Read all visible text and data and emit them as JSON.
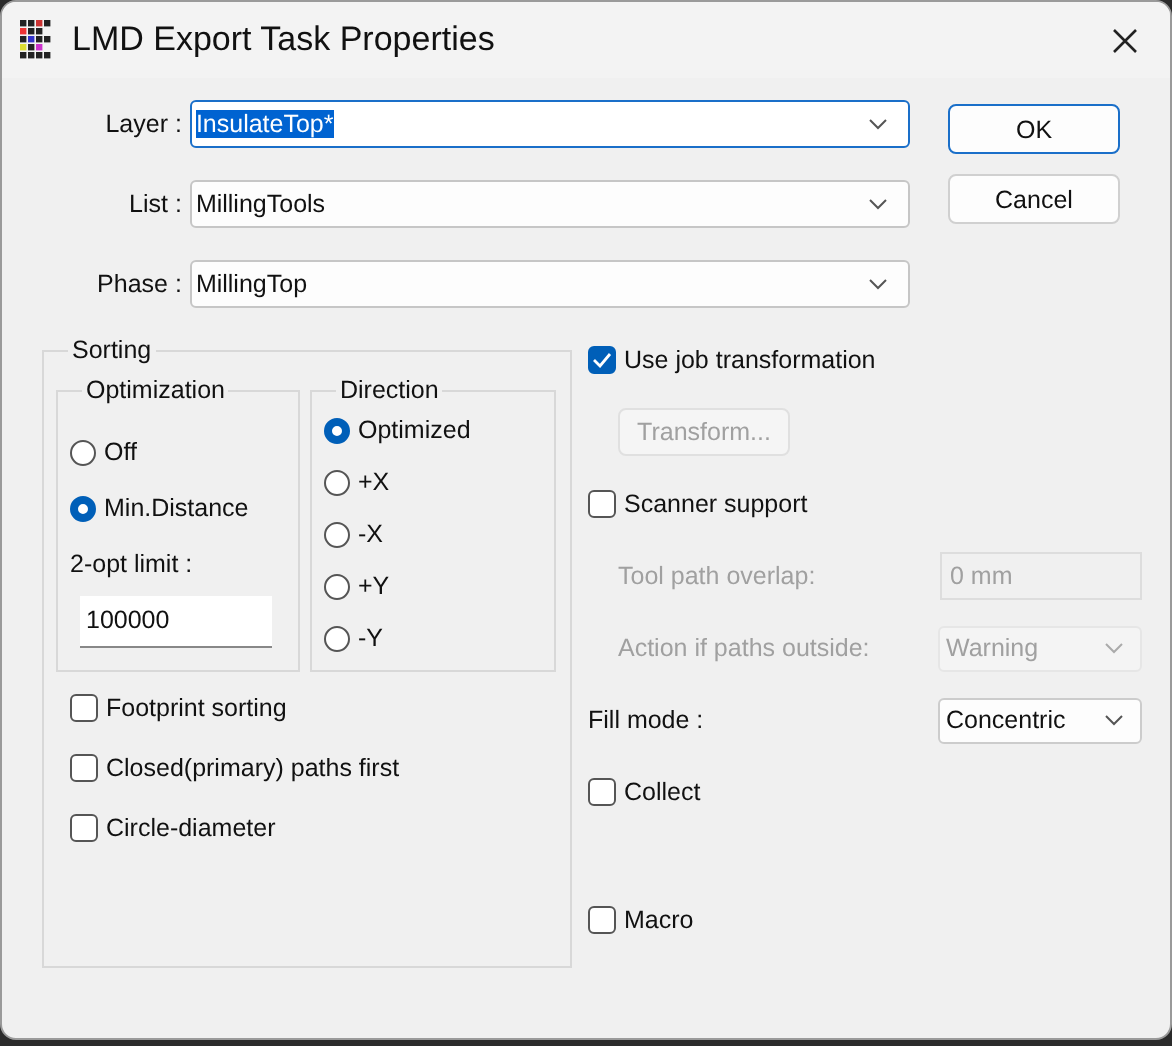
{
  "window": {
    "title": "LMD Export Task Properties"
  },
  "fields": [
    {
      "label": "Layer :",
      "value": "InsulateTop*",
      "focused": true
    },
    {
      "label": "List :",
      "value": "MillingTools",
      "focused": false
    },
    {
      "label": "Phase :",
      "value": "MillingTop",
      "focused": false
    }
  ],
  "buttons": [
    {
      "label": "OK",
      "default": true
    },
    {
      "label": "Cancel",
      "default": false
    }
  ],
  "sorting": {
    "title": "Sorting",
    "optimization": {
      "title": "Optimization",
      "options": [
        {
          "label": "Off",
          "selected": false
        },
        {
          "label": "Min.Distance",
          "selected": true
        }
      ],
      "limit_label": "2-opt limit :",
      "limit_value": "100000"
    },
    "direction": {
      "title": "Direction",
      "options": [
        {
          "label": "Optimized",
          "selected": true
        },
        {
          "label": "+X",
          "selected": false
        },
        {
          "label": "-X",
          "selected": false
        },
        {
          "label": "+Y",
          "selected": false
        },
        {
          "label": "-Y",
          "selected": false
        }
      ]
    },
    "checks": [
      {
        "label": "Footprint sorting",
        "checked": false
      },
      {
        "label": "Closed(primary) paths first",
        "checked": false
      },
      {
        "label": "Circle-diameter",
        "checked": false
      }
    ]
  },
  "options": [
    {
      "kind": "check",
      "label": "Use job transformation",
      "checked": true,
      "disabled": false
    },
    {
      "kind": "button",
      "label": "Transform...",
      "disabled": true
    },
    {
      "kind": "check",
      "label": "Scanner support",
      "checked": false,
      "disabled": false
    },
    {
      "kind": "field",
      "label": "Tool path overlap:",
      "value": "0 mm",
      "disabled": true
    },
    {
      "kind": "combo",
      "label": "Action if paths outside:",
      "value": "Warning",
      "disabled": true
    },
    {
      "kind": "combo",
      "label": "Fill mode :",
      "value": "Concentric",
      "disabled": false
    },
    {
      "kind": "check",
      "label": "Collect",
      "checked": false,
      "disabled": false
    }
  ],
  "bottom_options": [
    {
      "kind": "check",
      "label": "Macro",
      "checked": false,
      "disabled": false
    }
  ]
}
